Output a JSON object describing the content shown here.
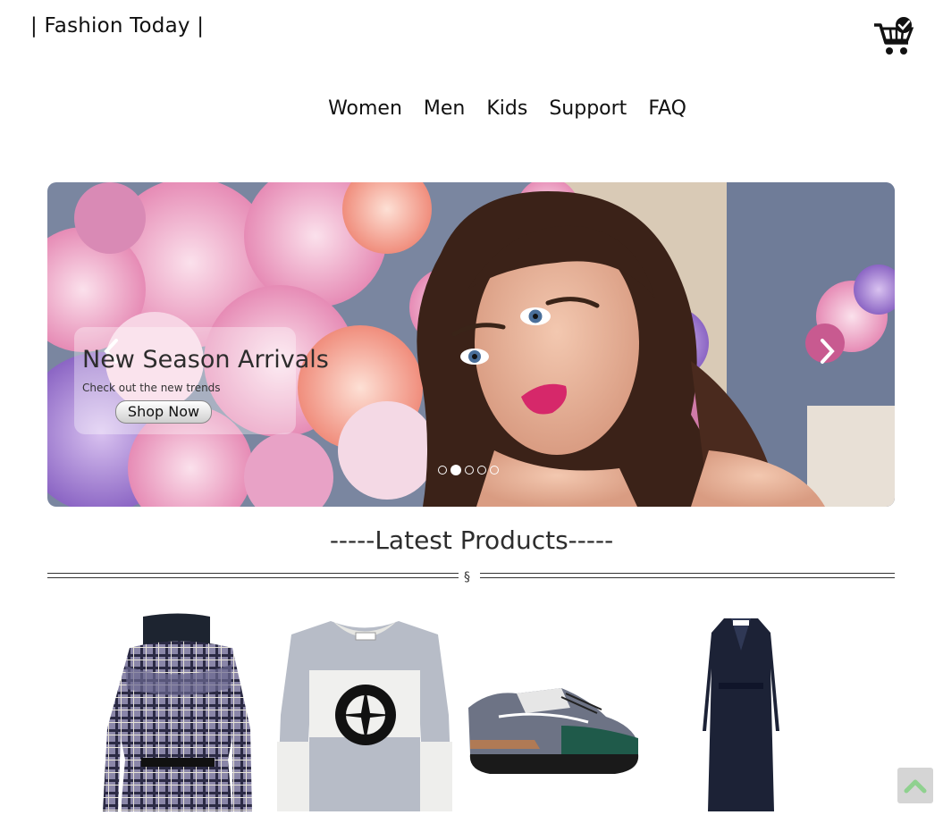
{
  "header": {
    "brand": "| Fashion Today |",
    "cart_icon": "shopping-cart-check-icon"
  },
  "nav": {
    "items": [
      "Women",
      "Men",
      "Kids",
      "Support",
      "FAQ"
    ]
  },
  "hero": {
    "prev_icon": "chevron-left-icon",
    "next_icon": "chevron-right-icon",
    "caption_title": "New Season Arrivals",
    "caption_subtitle": "Check out the new trends",
    "cta_label": "Shop Now",
    "slide_count": 5,
    "active_slide": 2
  },
  "products_section": {
    "title": "-----Latest Products-----",
    "divider_mark": "§",
    "products": [
      {
        "name": "plaid-ruffle-dress"
      },
      {
        "name": "stone-island-sweater"
      },
      {
        "name": "sneaker"
      },
      {
        "name": "navy-wrap-coat"
      }
    ]
  },
  "scroll_top_icon": "chevron-up-icon",
  "colors": {
    "text": "#111111",
    "scroll_top_bg": "#d5d5d5",
    "scroll_top_icon": "#8fd18f"
  }
}
